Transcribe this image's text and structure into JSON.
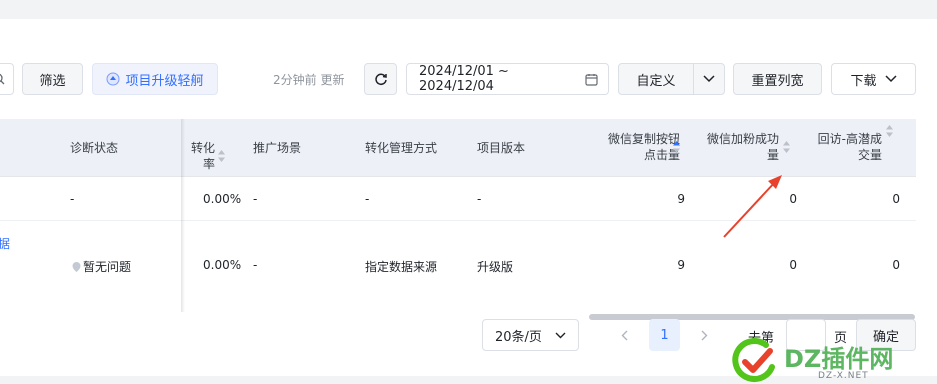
{
  "toolbar": {
    "filter_label": "筛选",
    "upgrade_label": "项目升级轻舸",
    "updated_text": "2分钟前 更新",
    "date_range": "2024/12/01 ~ 2024/12/04",
    "custom_label": "自定义",
    "reset_width_label": "重置列宽",
    "download_label": "下载"
  },
  "table": {
    "headers": {
      "diag_status": "诊断状态",
      "conversion_rate": "转化率",
      "promo_scene": "推广场景",
      "conv_mgmt": "转化管理方式",
      "project_version": "项目版本",
      "wechat_copy_1": "微信复制按钮",
      "wechat_copy_2": "点击量",
      "wechat_add_1": "微信加粉成功",
      "wechat_add_2": "量",
      "revisit_1": "回访-高潜成",
      "revisit_2": "交量"
    },
    "rows": [
      {
        "name": "",
        "diag_status": "-",
        "conversion_rate": "0.00%",
        "promo_scene": "-",
        "conv_mgmt": "-",
        "project_version": "-",
        "wechat_copy": "9",
        "wechat_add": "0",
        "revisit": "0"
      },
      {
        "name": "据",
        "diag_status": "暂无问题",
        "conversion_rate": "0.00%",
        "promo_scene": "-",
        "conv_mgmt": "指定数据来源",
        "project_version": "升级版",
        "wechat_copy": "9",
        "wechat_add": "0",
        "revisit": "0"
      }
    ]
  },
  "pagination": {
    "page_size": "20条/页",
    "current_page": "1",
    "goto_label": "去第",
    "page_suffix": "页",
    "confirm_label": "确定"
  },
  "watermark": {
    "brand": "DZ插件网",
    "domain": "DZ-X.NET"
  },
  "colors": {
    "accent": "#3370ff",
    "arrow": "#e8412c",
    "header_bg": "#eef0f8"
  }
}
